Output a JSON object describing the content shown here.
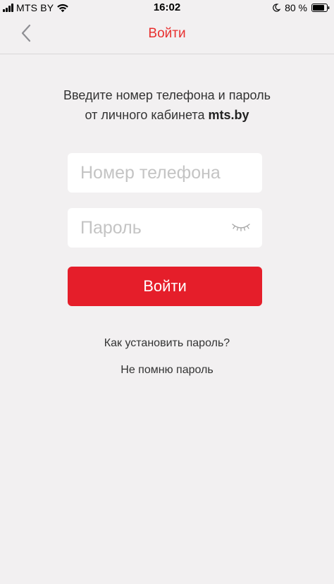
{
  "status_bar": {
    "carrier": "MTS BY",
    "time": "16:02",
    "battery_percent": "80 %",
    "icons": [
      "signal-icon",
      "wifi-icon",
      "moon-icon",
      "battery-icon"
    ]
  },
  "nav": {
    "title": "Войти",
    "back_icon": "chevron-left-icon"
  },
  "instruction": {
    "line1": "Введите номер телефона и пароль",
    "line2_prefix": "от личного кабинета ",
    "line2_bold": "mts.by"
  },
  "form": {
    "phone_placeholder": "Номер телефона",
    "phone_value": "",
    "password_placeholder": "Пароль",
    "password_value": "",
    "password_toggle_icon": "eye-closed-icon",
    "submit_label": "Войти"
  },
  "links": {
    "how_to_set_password": "Как установить пароль?",
    "forgot_password": "Не помню пароль"
  },
  "colors": {
    "accent": "#e51e2a",
    "title": "#e8302f",
    "background": "#f2f0f1"
  }
}
